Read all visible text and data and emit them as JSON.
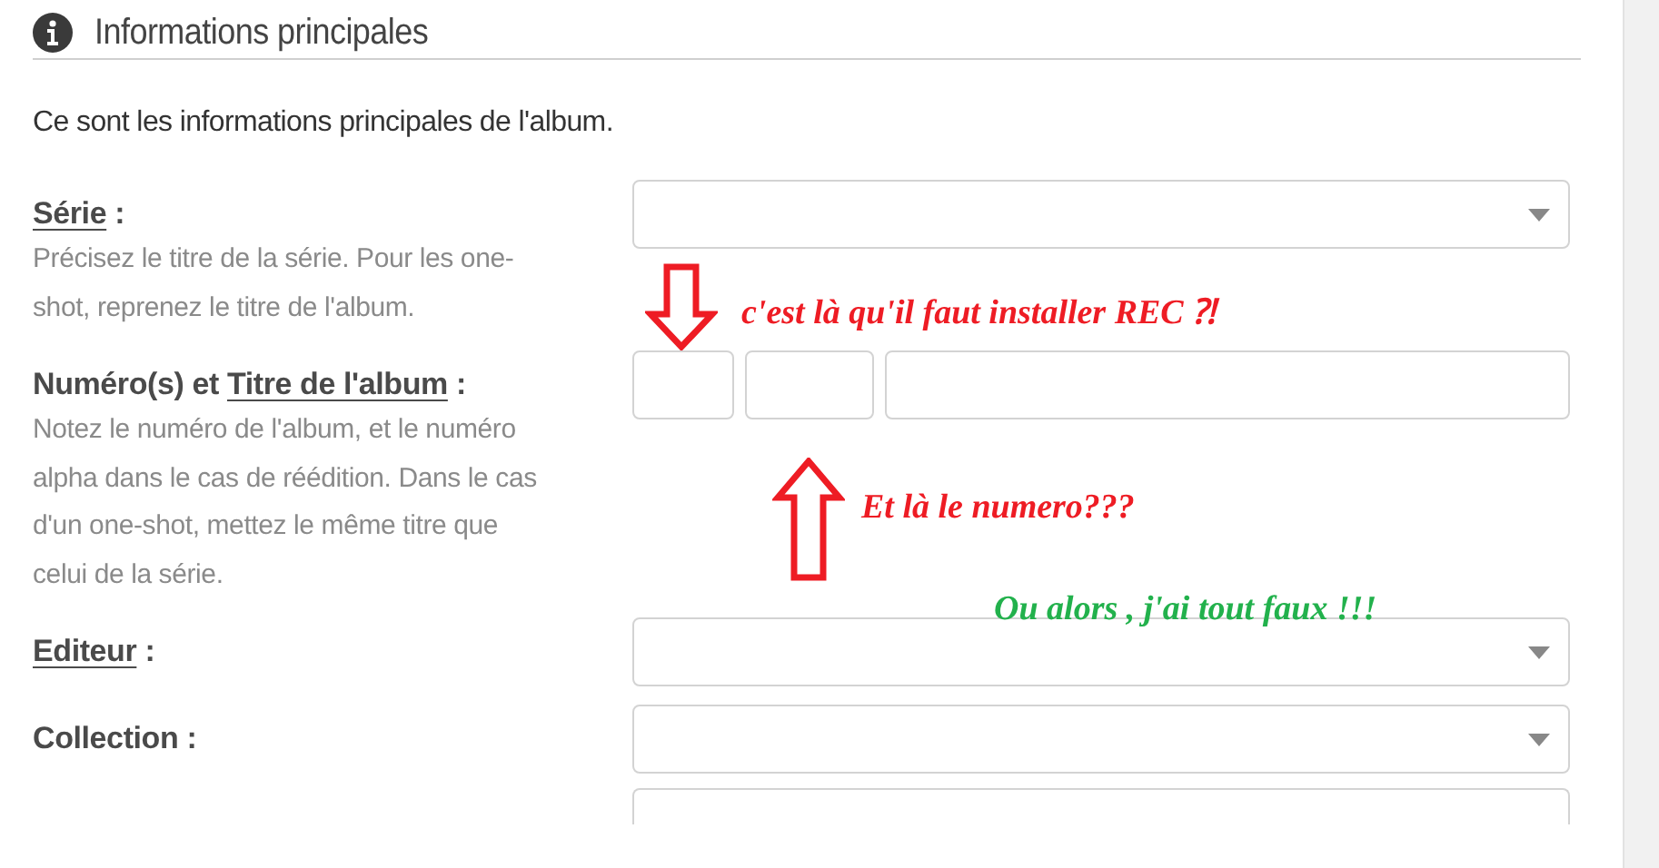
{
  "section": {
    "title": "Informations principales"
  },
  "intro": "Ce sont les informations principales de l'album.",
  "fields": [
    {
      "kind": "select",
      "label": [
        {
          "text": "Série",
          "underlined": true
        },
        {
          "text": " :",
          "underlined": false
        }
      ],
      "help": "Précisez le titre de la série. Pour les one-shot, reprenez le titre de l'album."
    },
    {
      "kind": "triple-input",
      "label": [
        {
          "text": "Numéro(s) et ",
          "underlined": false
        },
        {
          "text": "Titre de l'album",
          "underlined": true
        },
        {
          "text": " :",
          "underlined": false
        }
      ],
      "help": "Notez le numéro de l'album, et le numéro alpha dans le cas de réédition. Dans le cas d'un one-shot, mettez le même titre que celui de la série."
    },
    {
      "kind": "select",
      "label": [
        {
          "text": "Editeur",
          "underlined": true
        },
        {
          "text": " :",
          "underlined": false
        }
      ]
    },
    {
      "kind": "select",
      "label": [
        {
          "text": "Collection :",
          "underlined": false
        }
      ]
    },
    {
      "kind": "partial"
    }
  ],
  "annotations": [
    {
      "kind": "down-arrow",
      "color": "#ee1c24"
    },
    {
      "kind": "note",
      "text": "c'est là qu'il faut installer REC ⁈",
      "color": "#ee1c24"
    },
    {
      "kind": "up-arrow",
      "color": "#ee1c24"
    },
    {
      "kind": "note",
      "text": "Et là le numero???",
      "color": "#ee1c24"
    },
    {
      "kind": "note",
      "text": "Ou alors , j'ai tout faux !!!",
      "color": "#22b14c"
    }
  ]
}
